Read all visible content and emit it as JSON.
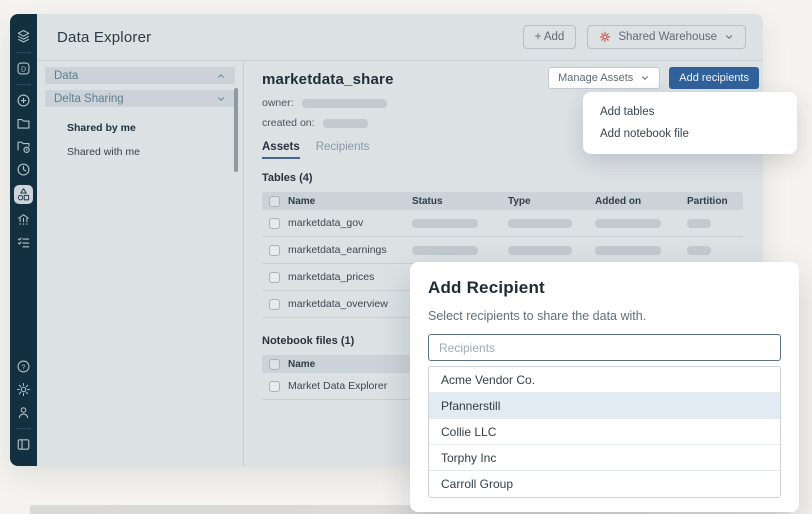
{
  "colors": {
    "accent_blue": "#31619b",
    "warehouse_red": "#cf5a50",
    "tab_underline": "#44688c",
    "highlight_row": "#e2eaf4",
    "rail_bg": "#12303f"
  },
  "topbar": {
    "title": "Data Explorer",
    "add_button": "+ Add",
    "warehouse_button": "Shared Warehouse"
  },
  "rail": {
    "icons": [
      "layers-logo",
      "databricks-d",
      "plus-circle",
      "folder",
      "folder-sync",
      "clock",
      "data-explorer-shapes",
      "org",
      "task-list"
    ],
    "bottom_icons": [
      "help",
      "settings",
      "profile",
      "panel-toggle"
    ]
  },
  "tree": {
    "sections": [
      {
        "label": "Data",
        "chevron": "up"
      },
      {
        "label": "Delta Sharing",
        "chevron": "down"
      }
    ],
    "items": [
      {
        "label": "Shared by me",
        "active": true
      },
      {
        "label": "Shared with me",
        "active": false
      }
    ]
  },
  "share": {
    "title": "marketdata_share",
    "owner_label": "owner:",
    "created_on_label": "created on:",
    "manage_assets_button": "Manage Assets",
    "add_recipients_button": "Add recipients",
    "tabs": [
      {
        "label": "Assets",
        "active": true
      },
      {
        "label": "Recipients",
        "active": false
      }
    ],
    "menu": [
      {
        "label": "Add tables"
      },
      {
        "label": "Add notebook file"
      }
    ]
  },
  "tables_section": {
    "title": "Tables (4)",
    "columns": [
      "Name",
      "Status",
      "Type",
      "Added on",
      "Partition"
    ],
    "rows": [
      {
        "name": "marketdata_gov"
      },
      {
        "name": "marketdata_earnings"
      },
      {
        "name": "marketdata_prices"
      },
      {
        "name": "marketdata_overview"
      }
    ]
  },
  "notebooks_section": {
    "title": "Notebook files (1)",
    "columns": [
      "Name"
    ],
    "rows": [
      {
        "name": "Market Data Explorer"
      }
    ]
  },
  "modal": {
    "title": "Add Recipient",
    "subtitle": "Select recipients to share the data with.",
    "input_placeholder": "Recipients",
    "options": [
      {
        "label": "Acme Vendor Co.",
        "highlighted": false
      },
      {
        "label": "Pfannerstill",
        "highlighted": true
      },
      {
        "label": "Collie LLC",
        "highlighted": false
      },
      {
        "label": "Torphy Inc",
        "highlighted": false
      },
      {
        "label": "Carroll Group",
        "highlighted": false
      }
    ]
  }
}
